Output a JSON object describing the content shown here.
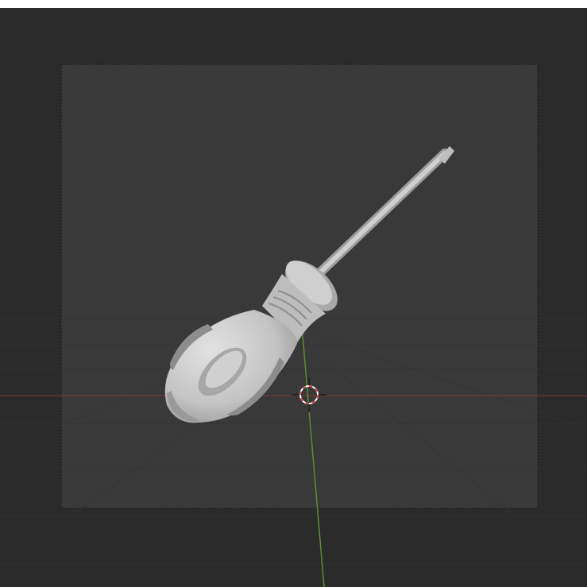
{
  "viewport": {
    "view": "camera",
    "object": "screwdriver",
    "colors": {
      "background": "#2b2b2b",
      "camera_frame": "#393939",
      "grid": "#353535",
      "x_axis": "#8a3b3b",
      "y_axis": "#6b8f3a",
      "object": "#c6c6c6",
      "cursor_red": "#d84a4a"
    },
    "icons": {
      "cursor": "3d-cursor-icon"
    }
  }
}
